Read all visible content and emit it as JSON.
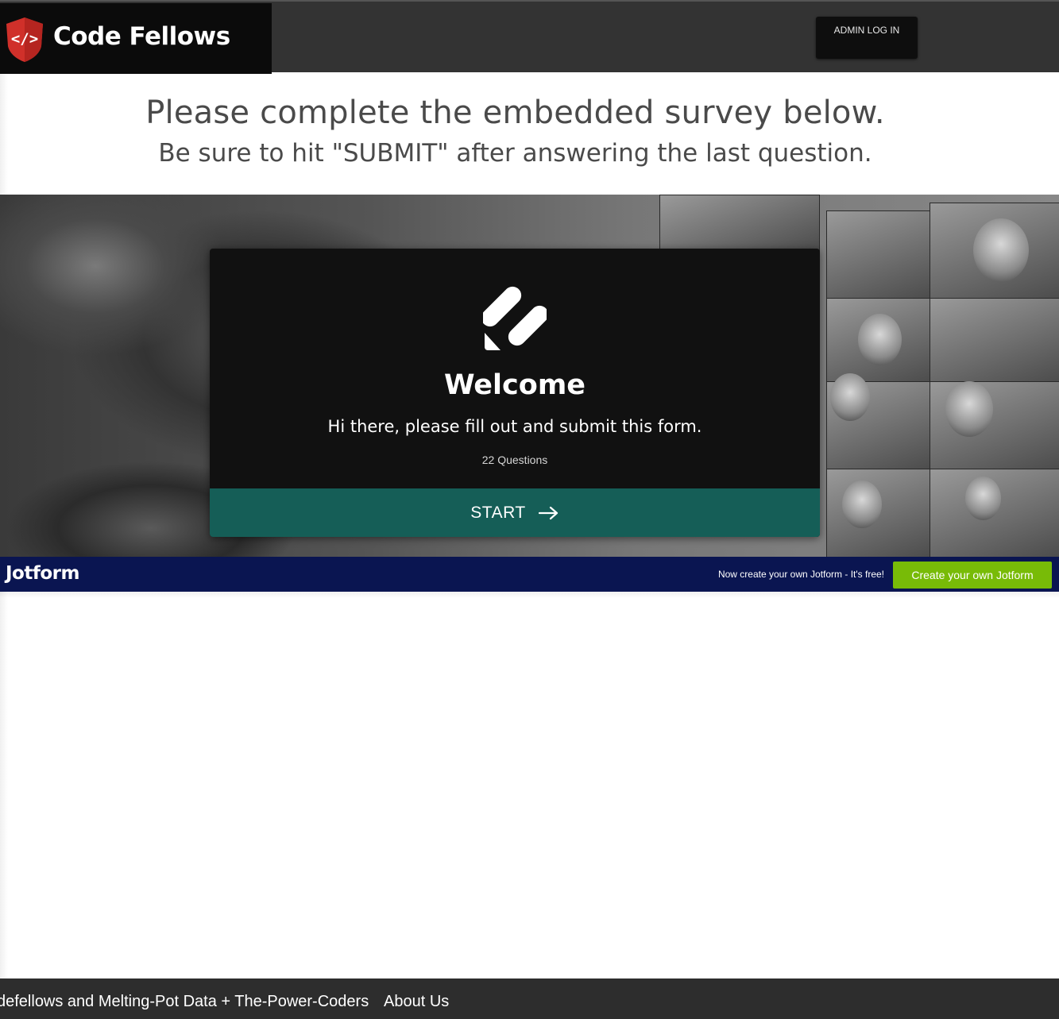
{
  "header": {
    "brand_name": "Code Fellows",
    "logo_icon": "code-shield-icon",
    "admin_login_label": "ADMIN LOG IN"
  },
  "intro": {
    "heading": "Please complete the embedded survey below.",
    "subheading": "Be sure to hit \"SUBMIT\" after answering the last question."
  },
  "form_card": {
    "logo_icon": "jotform-logo-icon",
    "title": "Welcome",
    "description": "Hi there, please fill out and submit this form.",
    "question_count": "22 Questions",
    "start_label": "START",
    "start_icon": "arrow-right-icon"
  },
  "jotform_bar": {
    "logo_text": "Jotform",
    "promo_text": "Now create your own Jotform - It's free!",
    "create_button_label": "Create your own Jotform"
  },
  "footer": {
    "credit_text": "defellows and Melting-Pot Data + The-Power-Coders",
    "about_link": "About Us"
  },
  "colors": {
    "header_bg": "#333333",
    "brand_bg": "#0b0b0b",
    "card_bg": "#111111",
    "start_button": "#155e57",
    "jotform_bar": "#0a1551",
    "create_button": "#78bb07",
    "footer_bg": "#2d2d2d",
    "logo_red": "#d0302a"
  }
}
